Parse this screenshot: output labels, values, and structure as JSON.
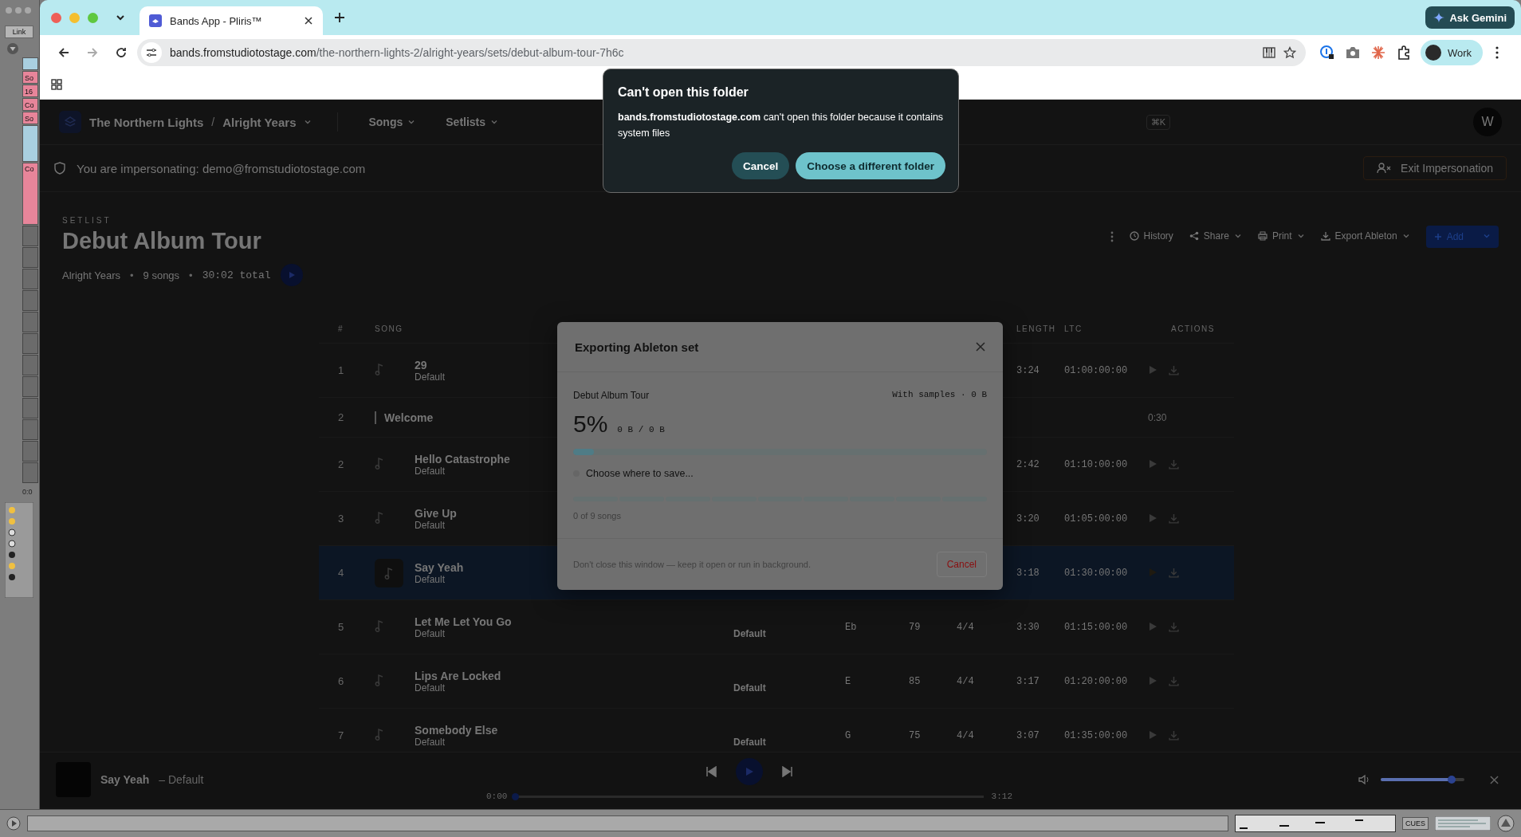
{
  "ableton": {
    "link": "Link",
    "clips": [
      "So",
      "16",
      "Co",
      "So"
    ],
    "clip_lower": "Co",
    "time": "0:0",
    "cues": "CUES"
  },
  "browser": {
    "tabs": [
      {
        "title": "Bands App - Pliris™",
        "selected": true
      }
    ],
    "ask_gemini": "Ask Gemini",
    "url_host": "bands.fromstudiotostage.com",
    "url_path": "/the-northern-lights-2/alright-years/sets/debut-album-tour-7h6c",
    "profile": "Work"
  },
  "header": {
    "band": "The Northern Lights",
    "separator": "/",
    "album": "Alright Years",
    "nav": [
      "Songs",
      "Setlists"
    ],
    "search_shortcut": "⌘K",
    "avatar": "W"
  },
  "impersonation": {
    "text": "You are impersonating: demo@fromstudiotostage.com",
    "button": "Exit Impersonation"
  },
  "setlist": {
    "eyebrow": "SETLIST",
    "title": "Debut Album Tour",
    "album": "Alright Years",
    "songs": "9 songs",
    "total": "30:02 total",
    "separator": "•",
    "actions": [
      {
        "label": "History",
        "kind": "history"
      },
      {
        "label": "Share",
        "kind": "share"
      },
      {
        "label": "Print",
        "kind": "print"
      },
      {
        "label": "Export Ableton",
        "kind": "export"
      }
    ],
    "add": "Add"
  },
  "table": {
    "columns": [
      "#",
      "SONG",
      "LENGTH",
      "LTC",
      "ACTIONS"
    ],
    "rows": [
      {
        "kind": "song",
        "num": "1",
        "title": "29",
        "subtitle": "Default",
        "length": "3:24",
        "ltc": "01:00:00:00",
        "selected": false
      },
      {
        "kind": "section",
        "num": "2",
        "title": "Welcome",
        "length": "0:30",
        "selected": false
      },
      {
        "kind": "song",
        "num": "2",
        "title": "Hello Catastrophe",
        "subtitle": "Default",
        "length": "2:42",
        "ltc": "01:10:00:00",
        "selected": false
      },
      {
        "kind": "song",
        "num": "3",
        "title": "Give Up",
        "subtitle": "Default",
        "length": "3:20",
        "ltc": "01:05:00:00",
        "selected": false
      },
      {
        "kind": "song",
        "num": "4",
        "title": "Say Yeah",
        "subtitle": "Default",
        "length": "3:18",
        "ltc": "01:30:00:00",
        "selected": true
      },
      {
        "kind": "song",
        "num": "5",
        "title": "Let Me Let You Go",
        "subtitle": "Default",
        "version": "Default",
        "key": "Eb",
        "bpm": "79",
        "signature": "4/4",
        "length": "3:30",
        "ltc": "01:15:00:00",
        "selected": false
      },
      {
        "kind": "song",
        "num": "6",
        "title": "Lips Are Locked",
        "subtitle": "Default",
        "version": "Default",
        "key": "E",
        "bpm": "85",
        "signature": "4/4",
        "length": "3:17",
        "ltc": "01:20:00:00",
        "selected": false
      },
      {
        "kind": "song",
        "num": "7",
        "title": "Somebody Else",
        "subtitle": "Default",
        "version": "Default",
        "key": "G",
        "bpm": "75",
        "signature": "4/4",
        "length": "3:07",
        "ltc": "01:35:00:00",
        "selected": false
      }
    ]
  },
  "export_modal": {
    "title": "Exporting Ableton set",
    "set_name": "Debut Album Tour",
    "mode": "With samples · 0 B",
    "percent": "5%",
    "bytes": "0 B / 0 B",
    "progress": {
      "level": 0.05
    },
    "step": "Choose where to save...",
    "segments": [
      {
        "done": false
      },
      {
        "done": false
      },
      {
        "done": false
      },
      {
        "done": false
      },
      {
        "done": false
      },
      {
        "done": false
      },
      {
        "done": false
      },
      {
        "done": false
      },
      {
        "done": false
      }
    ],
    "count": "0 of 9 songs",
    "footer": "Don't close this window — keep it open or run in background.",
    "cancel": "Cancel"
  },
  "folder_dialog": {
    "title": "Can't open this folder",
    "message": "**bands.fromstudiotostage.com** can't open this folder because it contains system files",
    "buttons": [
      "Cancel",
      "Choose a different folder"
    ]
  },
  "player": {
    "title": "Say Yeah",
    "version": "– Default",
    "elapsed": "0:00",
    "duration": "3:12",
    "progress": {
      "level": 0
    },
    "volume": {
      "level": 0.85
    }
  }
}
